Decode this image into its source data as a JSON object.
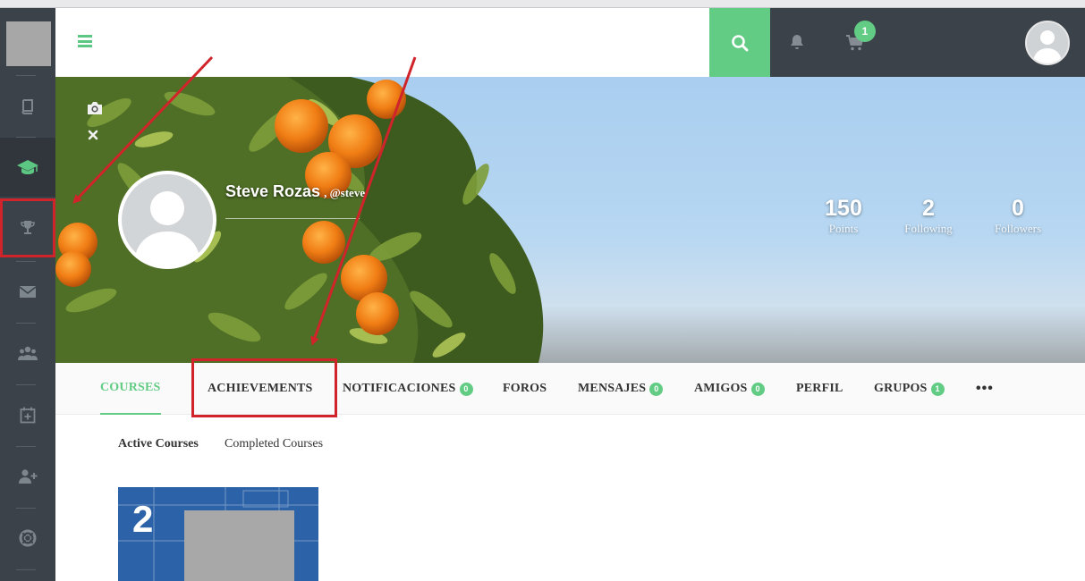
{
  "profile": {
    "name": "Steve Rozas",
    "handle": "@steve",
    "stats": [
      {
        "value": "150",
        "label": "Points"
      },
      {
        "value": "2",
        "label": "Following"
      },
      {
        "value": "0",
        "label": "Followers"
      }
    ]
  },
  "header": {
    "cart_badge": "1"
  },
  "tabs": [
    {
      "label": "COURSES",
      "badge": null
    },
    {
      "label": "ACHIEVEMENTS",
      "badge": null
    },
    {
      "label": "NOTIFICACIONES",
      "badge": "0"
    },
    {
      "label": "FOROS",
      "badge": null
    },
    {
      "label": "MENSAJES",
      "badge": "0"
    },
    {
      "label": "AMIGOS",
      "badge": "0"
    },
    {
      "label": "PERFIL",
      "badge": null
    },
    {
      "label": "GRUPOS",
      "badge": "1"
    }
  ],
  "more_label": "•••",
  "subtabs": [
    {
      "label": "Active Courses"
    },
    {
      "label": "Completed Courses"
    }
  ],
  "course_card": {
    "number": "2"
  },
  "colors": {
    "accent": "#62cc84",
    "sidebar": "#3c4249",
    "annotation": "#d0242a"
  }
}
